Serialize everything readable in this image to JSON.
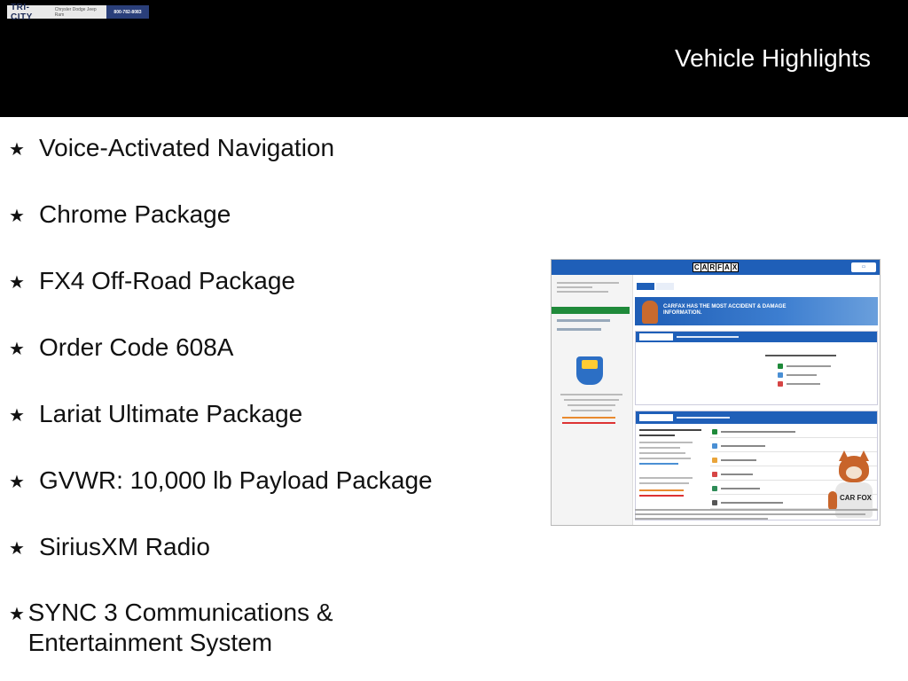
{
  "header": {
    "title": "Vehicle Highlights",
    "logo_text": "TRI-CITY",
    "logo_tagline": "Chrysler Dodge Jeep Ram",
    "logo_phone": "800-782-8083"
  },
  "highlights": [
    {
      "label": "Voice-Activated Navigation"
    },
    {
      "label": "Chrome Package"
    },
    {
      "label": "FX4 Off-Road Package"
    },
    {
      "label": "Order Code 608A"
    },
    {
      "label": "Lariat Ultimate Package"
    },
    {
      "label": "GVWR: 10,000 lb Payload Package"
    },
    {
      "label": "SiriusXM Radio"
    },
    {
      "label": "SYNC 3 Communications & Entertainment System"
    }
  ],
  "bullet_icon": "star-icon",
  "carfax_preview": {
    "logo_letters": [
      "C",
      "A",
      "R",
      "F",
      "A",
      "X"
    ],
    "banner_text": "CARFAX HAS THE MOST ACCIDENT & DAMAGE INFORMATION.",
    "shirt_text": "CAR FOX",
    "colors": {
      "brand_blue": "#1f5fb8",
      "nav_green": "#1f8a3a",
      "fox_orange": "#c8642a"
    }
  }
}
